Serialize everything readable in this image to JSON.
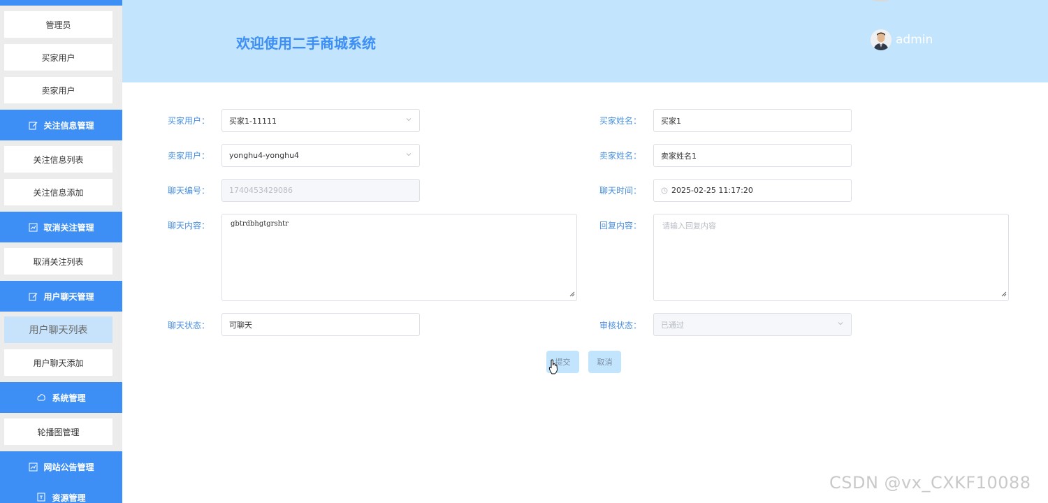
{
  "sidebar": {
    "items": [
      {
        "label": "管理员"
      },
      {
        "label": "买家用户"
      },
      {
        "label": "卖家用户"
      }
    ],
    "sections": [
      {
        "title": "关注信息管理",
        "icon": "edit-icon",
        "items": [
          {
            "label": "关注信息列表"
          },
          {
            "label": "关注信息添加"
          }
        ]
      },
      {
        "title": "取消关注管理",
        "icon": "chart-icon",
        "items": [
          {
            "label": "取消关注列表"
          }
        ]
      },
      {
        "title": "用户聊天管理",
        "icon": "edit-icon",
        "items": [
          {
            "label": "用户聊天列表",
            "active": true
          },
          {
            "label": "用户聊天添加"
          }
        ]
      },
      {
        "title": "系统管理",
        "icon": "cloud-icon",
        "items": [
          {
            "label": "轮播图管理"
          }
        ]
      },
      {
        "title": "网站公告管理",
        "icon": "chart-icon",
        "items": []
      },
      {
        "title": "资源管理",
        "icon": "doc-icon",
        "items": []
      }
    ]
  },
  "header": {
    "title": "欢迎使用二手商城系统",
    "user": "admin"
  },
  "form": {
    "buyer_user": {
      "label": "买家用户：",
      "value": "买家1-11111"
    },
    "buyer_name": {
      "label": "买家姓名：",
      "value": "买家1"
    },
    "seller_user": {
      "label": "卖家用户：",
      "value": "yonghu4-yonghu4"
    },
    "seller_name": {
      "label": "卖家姓名：",
      "value": "卖家姓名1"
    },
    "chat_id": {
      "label": "聊天编号：",
      "value": "1740453429086"
    },
    "chat_time": {
      "label": "聊天时间：",
      "value": "2025-02-25 11:17:20"
    },
    "chat_content": {
      "label": "聊天内容：",
      "value": "gbtrdbhgtgrshtr"
    },
    "reply_content": {
      "label": "回复内容：",
      "placeholder": "请输入回复内容"
    },
    "chat_status": {
      "label": "聊天状态：",
      "value": "可聊天"
    },
    "review_status": {
      "label": "审核状态：",
      "value": "已通过"
    }
  },
  "buttons": {
    "submit": "提交",
    "cancel": "取消"
  },
  "watermark": "CSDN @vx_CXKF10088",
  "colors": {
    "accent": "#3d8ff5",
    "header_bg": "#c2e4fc",
    "label": "#4a8fe0"
  }
}
